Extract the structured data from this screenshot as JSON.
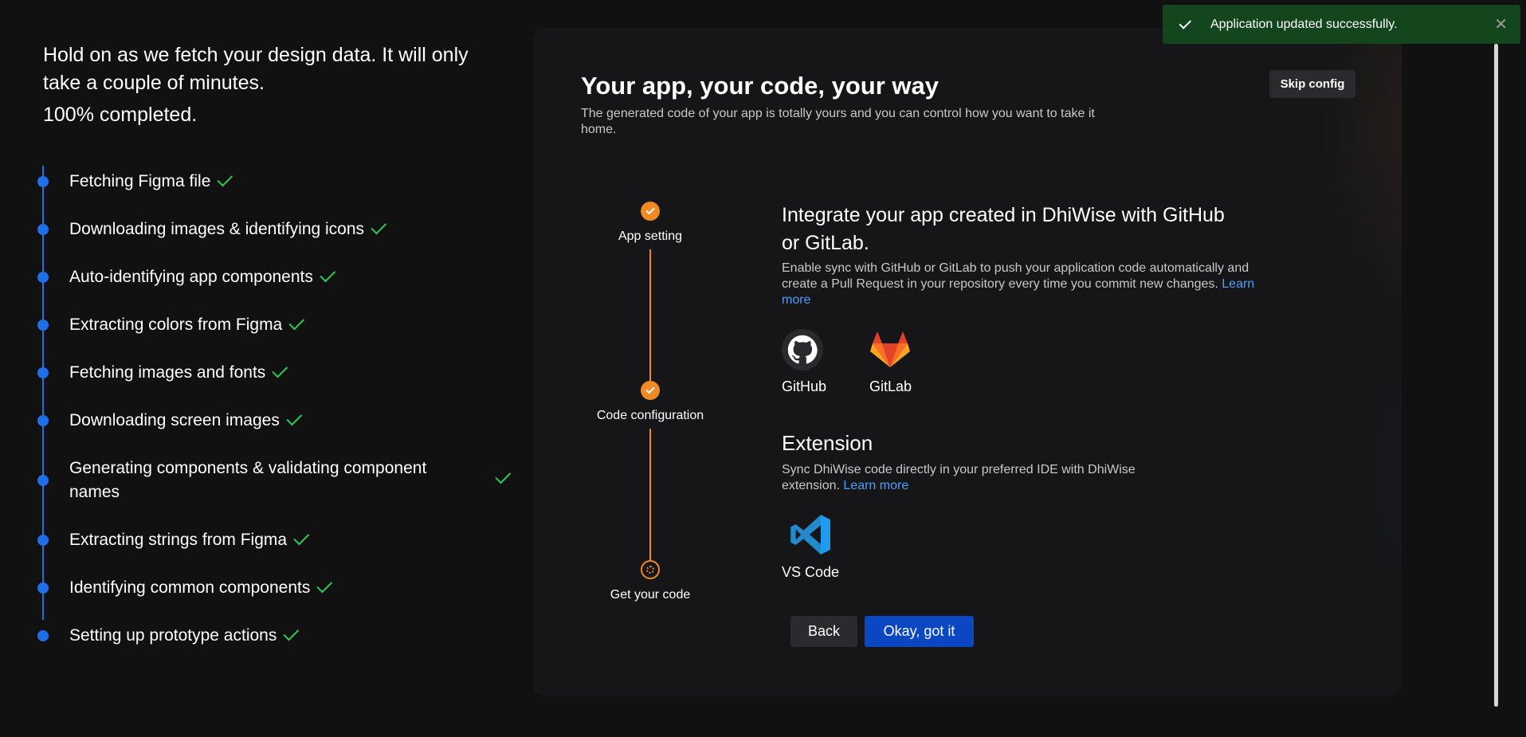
{
  "progress": {
    "heading": "Hold on as we fetch your design data. It will only take a couple of minutes.",
    "percent_text": "100% completed.",
    "steps": [
      {
        "label": "Fetching Figma file"
      },
      {
        "label": "Downloading images & identifying icons"
      },
      {
        "label": "Auto-identifying app components"
      },
      {
        "label": "Extracting colors from Figma"
      },
      {
        "label": "Fetching images and fonts"
      },
      {
        "label": "Downloading screen images"
      },
      {
        "label": "Generating components & validating component names"
      },
      {
        "label": "Extracting strings from Figma"
      },
      {
        "label": "Identifying common components"
      },
      {
        "label": "Setting up prototype actions"
      }
    ]
  },
  "card": {
    "title": "Your app, your code, your way",
    "subtitle": "The generated code of your app is totally yours and you can control how you want to take it home.",
    "skip_label": "Skip config",
    "stepper": [
      {
        "label": "App setting",
        "status": "done"
      },
      {
        "label": "Code configuration",
        "status": "done"
      },
      {
        "label": "Get your code",
        "status": "current"
      }
    ],
    "integration": {
      "title": "Integrate your app created in DhiWise with GitHub or GitLab.",
      "description": "Enable sync with GitHub or GitLab to push your application code automatically and create a Pull Request in your repository every time you commit new changes.",
      "learn_more": "Learn more",
      "options": [
        {
          "label": "GitHub",
          "icon": "github-icon"
        },
        {
          "label": "GitLab",
          "icon": "gitlab-icon"
        }
      ]
    },
    "extension": {
      "title": "Extension",
      "description": "Sync DhiWise code directly in your preferred IDE with DhiWise extension.",
      "learn_more": "Learn more",
      "item_label": "VS Code"
    },
    "back_label": "Back",
    "ok_label": "Okay, got it"
  },
  "toast": {
    "message": "Application updated successfully.",
    "close_symbol": "✕"
  },
  "colors": {
    "accent_orange": "#f08a24",
    "progress_blue": "#1e6fe8",
    "check_green": "#2ecc55",
    "primary_button": "#0b47c2",
    "toast_bg": "#14461e"
  }
}
